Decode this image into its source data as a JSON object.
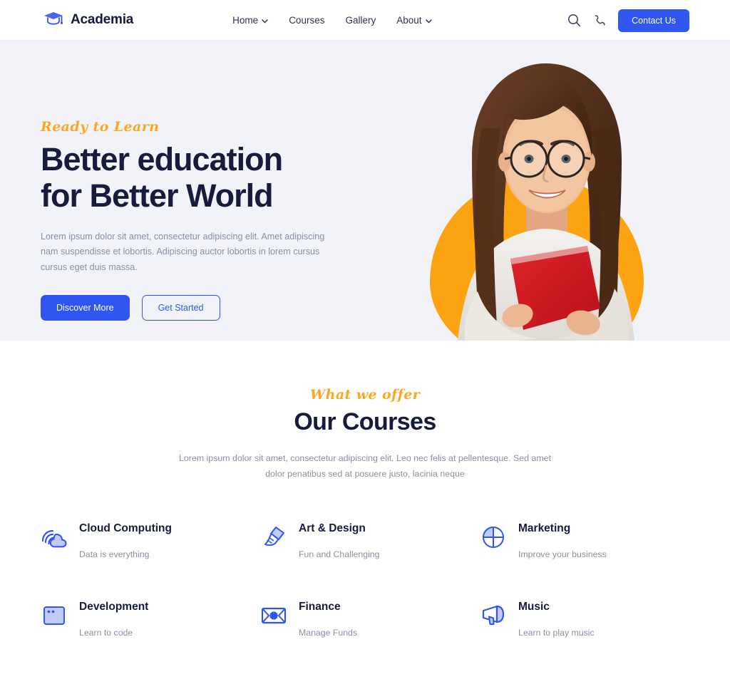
{
  "header": {
    "brand": "Academia",
    "logo_icon": "graduation-cap-icon",
    "nav": [
      {
        "label": "Home",
        "has_dropdown": true,
        "chevron": "⌄"
      },
      {
        "label": "Courses",
        "has_dropdown": false,
        "chevron": ""
      },
      {
        "label": "Gallery",
        "has_dropdown": false,
        "chevron": ""
      },
      {
        "label": "About",
        "has_dropdown": true,
        "chevron": "⌄"
      }
    ],
    "search_icon": "search-icon",
    "phone_icon": "phone-icon",
    "contact_label": "Contact Us"
  },
  "hero": {
    "eyebrow": "Ready to Learn",
    "title_line1": "Better education",
    "title_line2": "for Better World",
    "paragraph": "Lorem ipsum dolor sit amet, consectetur adipiscing elit. Amet adipiscing nam suspendisse et lobortis. Adipiscing auctor lobortis in lorem cursus cursus eget duis massa.",
    "primary_label": "Discover More",
    "secondary_label": "Get Started",
    "image_alt": "student-with-red-book"
  },
  "courses": {
    "eyebrow": "What we offer",
    "title": "Our Courses",
    "description": "Lorem ipsum dolor sit amet, consectetur adipiscing elit. Leo nec felis at pellentesque. Sed amet dolor penatibus sed at posuere justo, lacinia neque",
    "items": [
      {
        "title": "Cloud Computing",
        "subtitle": "Data is everything",
        "icon": "cloud-icon"
      },
      {
        "title": "Art & Design",
        "subtitle": "Fun and Challenging",
        "icon": "paintbrush-icon"
      },
      {
        "title": "Marketing",
        "subtitle": "Improve your business",
        "icon": "pie-chart-icon"
      },
      {
        "title": "Development",
        "subtitle": "Learn to code",
        "icon": "browser-window-icon"
      },
      {
        "title": "Finance",
        "subtitle": "Manage Funds",
        "icon": "banknote-icon"
      },
      {
        "title": "Music",
        "subtitle": "Learn to play music",
        "icon": "megaphone-icon"
      }
    ]
  },
  "colors": {
    "accent_blue": "#2f56f0",
    "accent_orange": "#fca311",
    "navy": "#171b3c",
    "hero_bg": "#f2f3f8",
    "muted_text": "#8a8fa3",
    "icon_fill": "#c2cbf7"
  }
}
